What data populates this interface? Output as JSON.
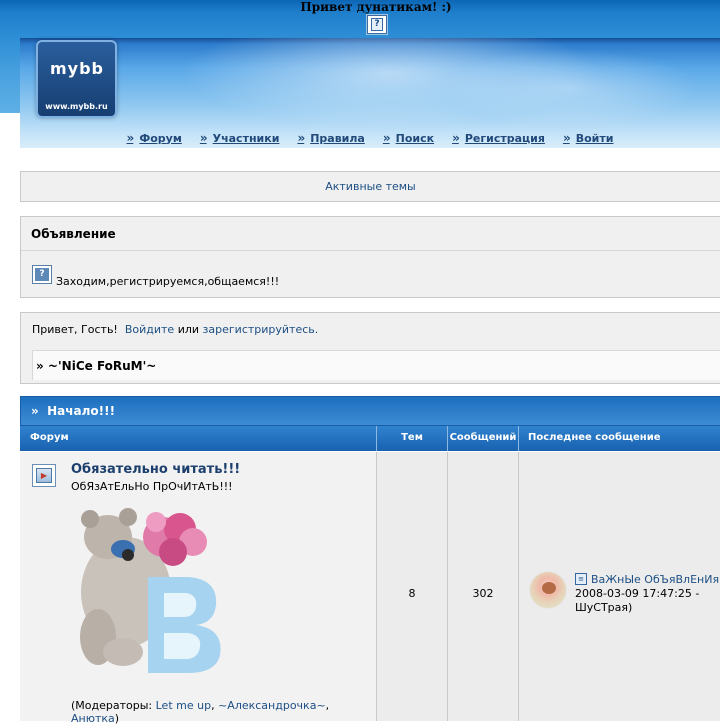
{
  "header": {
    "greeting": "Привет дунатикам! :)",
    "logo_text": "mybb",
    "logo_url": "www.mybb.ru"
  },
  "nav": {
    "items": [
      {
        "label": "Форум"
      },
      {
        "label": "Участники"
      },
      {
        "label": "Правила"
      },
      {
        "label": "Поиск"
      },
      {
        "label": "Регистрация"
      },
      {
        "label": "Войти"
      }
    ]
  },
  "active_topics": {
    "label": "Активные темы"
  },
  "announcement": {
    "title": "Объявление",
    "text": "Заходим,регистрируемся,общаемся!!!"
  },
  "guest": {
    "greeting": "Привет, Гость!",
    "login_link": "Войдите",
    "or_text": "или",
    "register_link": "зарегистрируйтесь."
  },
  "breadcrumb": {
    "text": "» ~'NiCe FoRuM'~"
  },
  "category": {
    "title": "Начало!!!",
    "columns": {
      "forum": "Форум",
      "topics": "Тем",
      "posts": "Сообщений",
      "last_post": "Последнее сообщение"
    },
    "forums": [
      {
        "name": "Обязательно читать!!!",
        "description": "ОбЯзАтЕльНо ПрОчИтАтЬ!!!",
        "moderators_prefix": "(Модераторы:",
        "moderators": [
          "Let me up",
          "~Александрочка~",
          "Анютка"
        ],
        "topics": "8",
        "posts": "302",
        "last_post": {
          "title": "ВаЖнЫе ОбЪяВлЕнИя",
          "date": "2008-03-09 17:47:25 -",
          "author": "ШуСТрая)"
        }
      }
    ]
  },
  "colors": {
    "header_blue": "#1e7ecb",
    "link": "#1d4f85",
    "panel_bg": "#f0f0f0"
  }
}
